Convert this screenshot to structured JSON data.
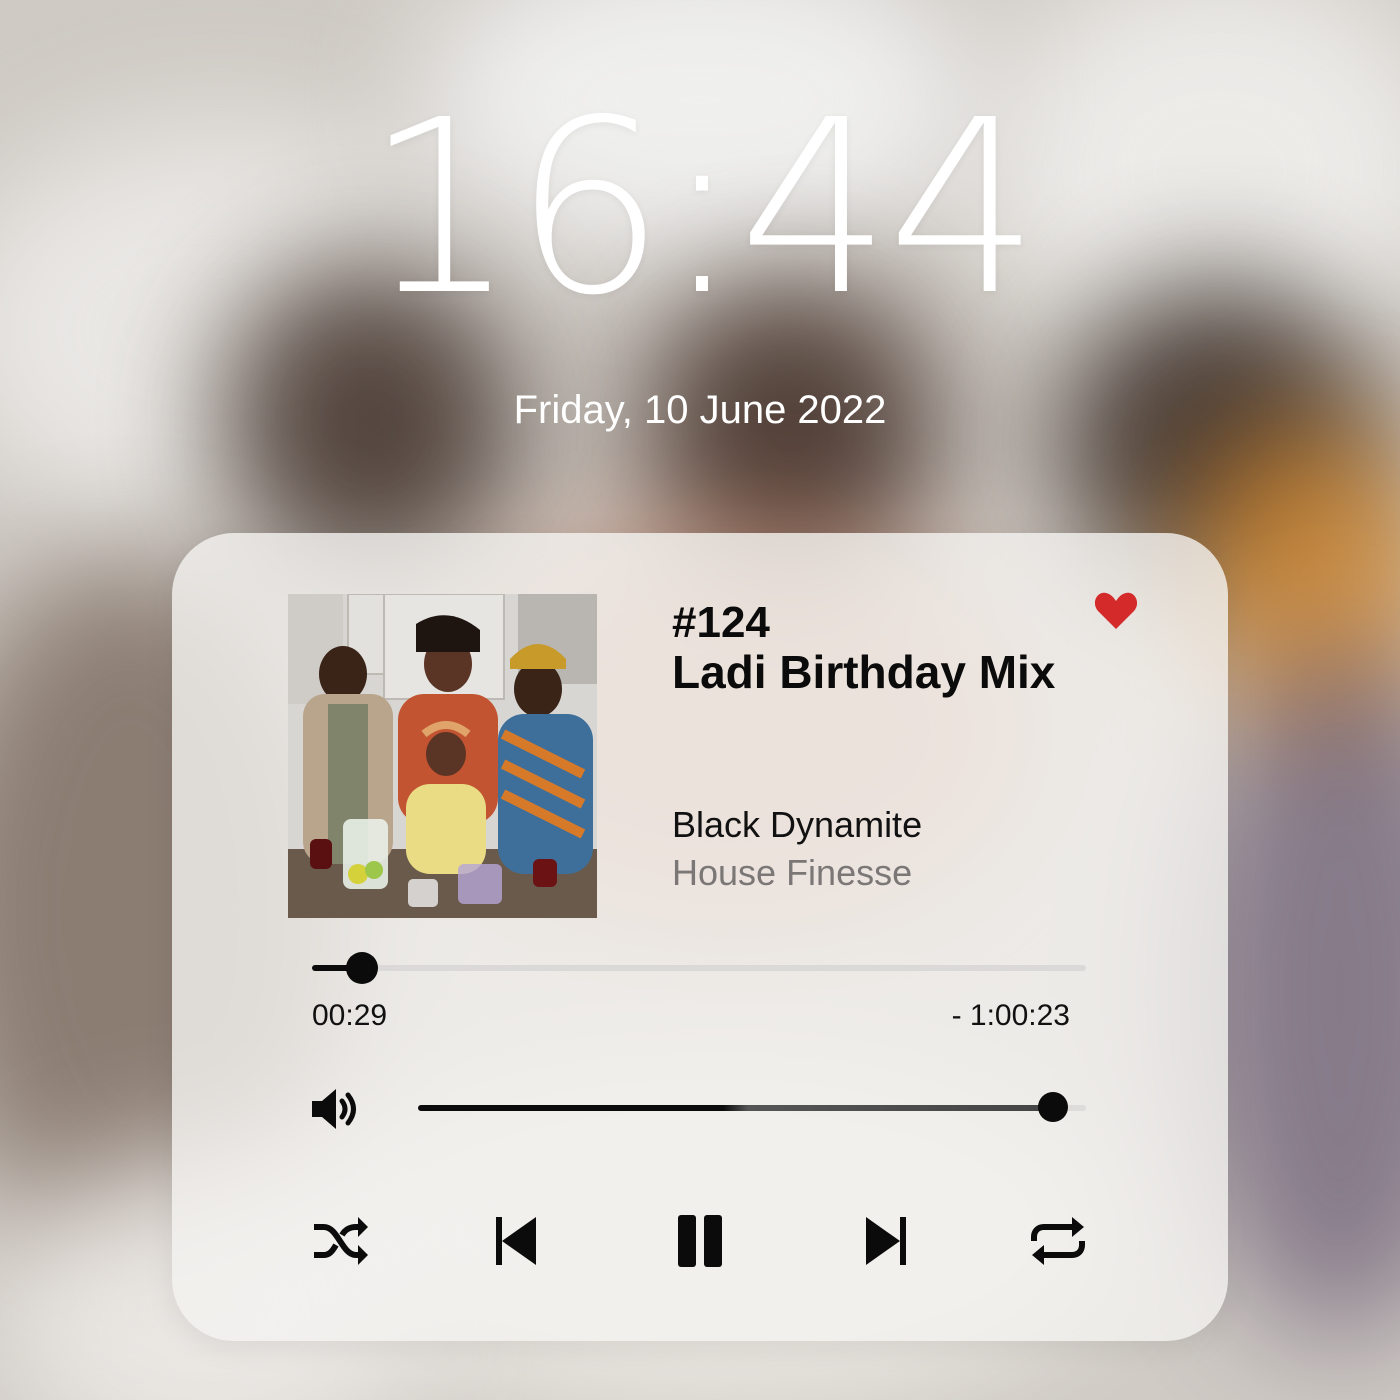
{
  "lockscreen": {
    "time": "16:44",
    "date": "Friday, 10 June 2022"
  },
  "player": {
    "episode_number": "#124",
    "title": "Ladi Birthday Mix",
    "artist": "Black Dynamite",
    "album": "House Finesse",
    "liked": true,
    "progress": {
      "elapsed": "00:29",
      "remaining": "- 1:00:23",
      "fraction": 0.065
    },
    "volume": {
      "fraction": 0.95
    },
    "controls": {
      "shuffle_icon": "shuffle-icon",
      "previous_icon": "skip-previous-icon",
      "play_state_icon": "pause-icon",
      "next_icon": "skip-next-icon",
      "repeat_icon": "repeat-icon"
    }
  },
  "colors": {
    "accent": "#0b0b0b",
    "heart": "#d42a2a",
    "secondary_text": "#7a7776"
  }
}
